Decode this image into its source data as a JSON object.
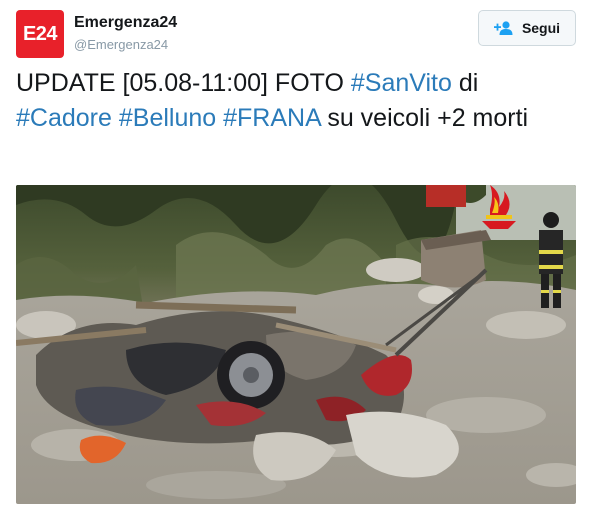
{
  "account": {
    "avatar_text": "E24",
    "name": "Emergenza24",
    "handle": "@Emergenza24",
    "brand_color": "#e8212a"
  },
  "follow_button": {
    "label": "Segui",
    "icon": "follow-user-icon"
  },
  "tweet": {
    "text_1": "UPDATE [05.08-11:00] FOTO ",
    "hashtag_1": "#SanVito",
    "text_2": " di ",
    "hashtag_2": "#Cadore",
    "text_3": " ",
    "hashtag_3": "#Belluno",
    "text_4": " ",
    "hashtag_4": "#FRANA",
    "text_5": " su veicoli +2 morti",
    "link_color": "#2b7bb9"
  },
  "media": {
    "icon": "fire-brigade-emblem-icon"
  }
}
